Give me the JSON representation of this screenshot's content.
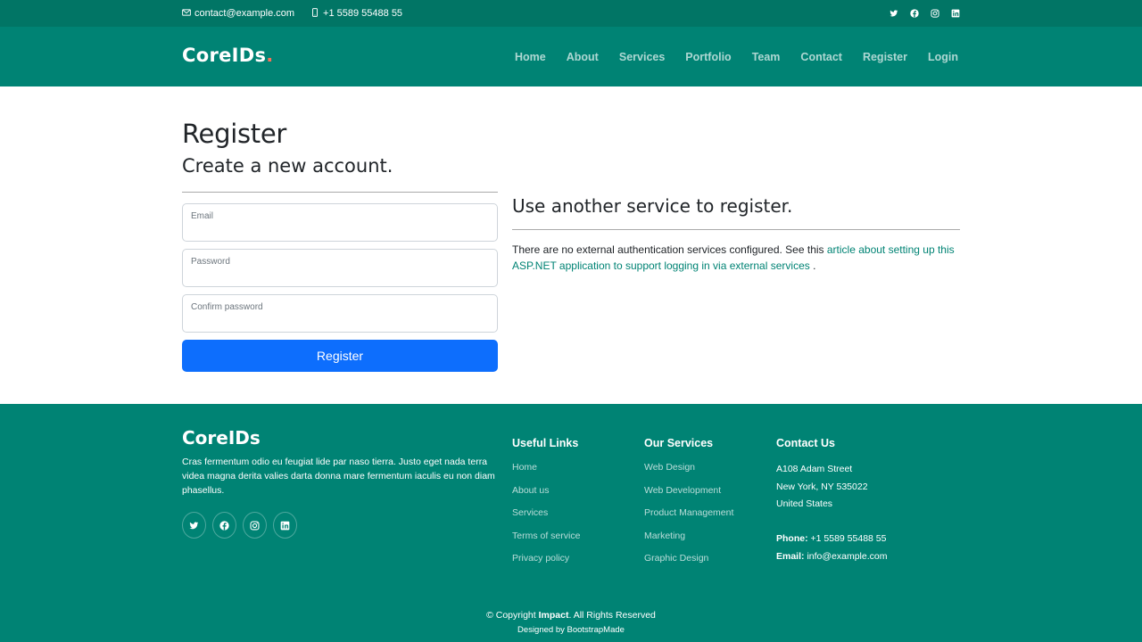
{
  "topbar": {
    "email": "contact@example.com",
    "phone": "+1 5589 55488 55",
    "socials": [
      "twitter-icon",
      "facebook-icon",
      "instagram-icon",
      "linkedin-icon"
    ]
  },
  "header": {
    "logo_text": "CoreIDs",
    "logo_dot": ".",
    "nav": [
      "Home",
      "About",
      "Services",
      "Portfolio",
      "Team",
      "Contact",
      "Register",
      "Login"
    ]
  },
  "main": {
    "title": "Register",
    "subtitle": "Create a new account.",
    "email_label": "Email",
    "password_label": "Password",
    "confirm_label": "Confirm password",
    "register_button": "Register",
    "external_title": "Use another service to register.",
    "external_text_before": "There are no external authentication services configured. See this ",
    "external_link": "article about setting up this ASP.NET application to support logging in via external services",
    "external_text_after": " ."
  },
  "footer": {
    "logo": "CoreIDs",
    "description": "Cras fermentum odio eu feugiat lide par naso tierra. Justo eget nada terra videa magna derita valies darta donna mare fermentum iaculis eu non diam phasellus.",
    "useful_links_title": "Useful Links",
    "useful_links": [
      "Home",
      "About us",
      "Services",
      "Terms of service",
      "Privacy policy"
    ],
    "services_title": "Our Services",
    "services": [
      "Web Design",
      "Web Development",
      "Product Management",
      "Marketing",
      "Graphic Design"
    ],
    "contact_title": "Contact Us",
    "address_line1": "A108 Adam Street",
    "address_line2": "New York, NY 535022",
    "address_line3": "United States",
    "phone_label": "Phone:",
    "phone": "+1 5589 55488 55",
    "email_label": "Email:",
    "email": "info@example.com",
    "copyright_prefix": "© Copyright ",
    "copyright_brand": "Impact",
    "copyright_suffix": ". All Rights Reserved",
    "designed_by": "Designed by BootstrapMade"
  },
  "colors": {
    "brand": "#008374",
    "topbar": "#017565",
    "accent_dot": "#f96f59",
    "primary_button": "#0d6efd"
  }
}
